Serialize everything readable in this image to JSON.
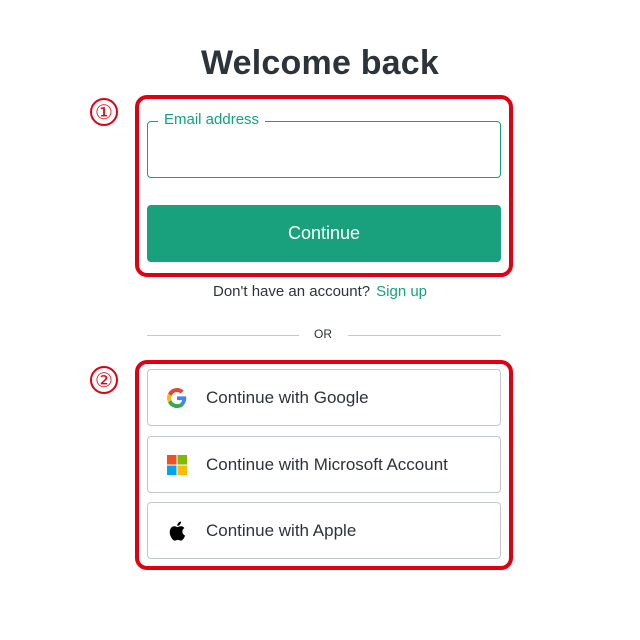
{
  "page": {
    "title": "Welcome back"
  },
  "annotations": {
    "callout_1": "①",
    "callout_2": "②"
  },
  "email": {
    "label": "Email address",
    "value": "",
    "placeholder": ""
  },
  "continue_button": {
    "label": "Continue"
  },
  "signup": {
    "prompt": "Don't have an account?",
    "link_label": "Sign up"
  },
  "divider": {
    "label": "OR"
  },
  "social_buttons": [
    {
      "label": "Continue with Google",
      "icon": "google-icon"
    },
    {
      "label": "Continue with Microsoft Account",
      "icon": "microsoft-icon"
    },
    {
      "label": "Continue with Apple",
      "icon": "apple-icon"
    }
  ],
  "colors": {
    "accent": "#10a37f",
    "button_fill": "#18a17c",
    "annotation_red": "#e00012",
    "border_gray": "#c2c8d0",
    "text": "#2d333a"
  }
}
